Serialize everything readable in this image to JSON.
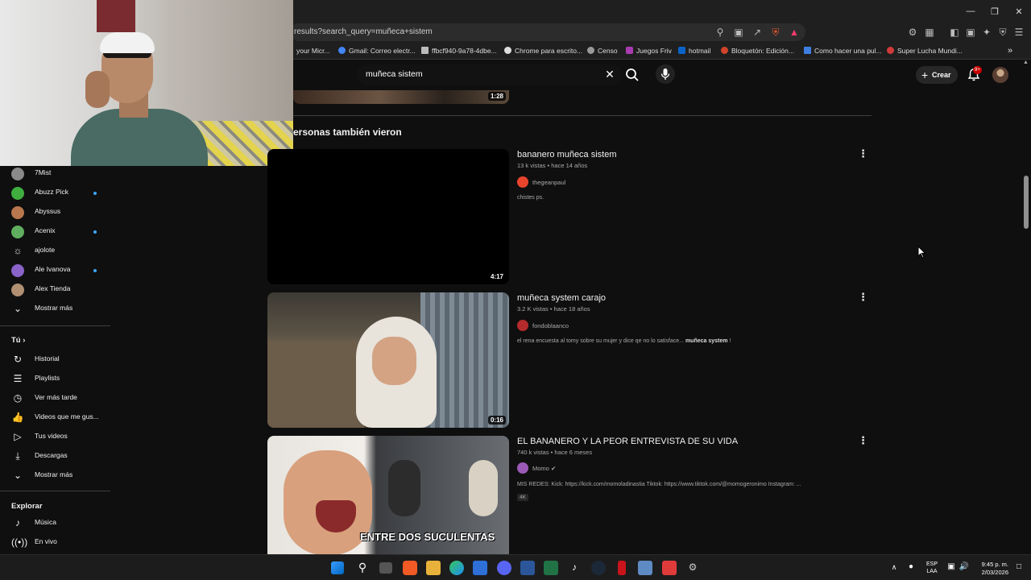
{
  "browser": {
    "url": "results?search_query=muñeca+sistem",
    "bookmarks": [
      "your Micr...",
      "Gmail: Correo electr...",
      "ffbcf940-9a78-4dbe...",
      "Chrome para escrito...",
      "Censo",
      "Juegos Friv",
      "hotmail",
      "Bloquetón: Edición...",
      "Como hacer una pul...",
      "Super Lucha Mundi..."
    ]
  },
  "header": {
    "search_value": "muñeca sistem",
    "create_label": "Crear",
    "notification_badge": "9+"
  },
  "sidebar": {
    "subscriptions": [
      {
        "label": "7Mist",
        "color": "#8a8a8a",
        "dot": false
      },
      {
        "label": "Abuzz Pick",
        "color": "#3fae3f",
        "dot": true
      },
      {
        "label": "Abyssus",
        "color": "#b8774d",
        "dot": false
      },
      {
        "label": "Acenix",
        "color": "#5fae5f",
        "dot": true
      },
      {
        "label": "ajolote",
        "color": "#d8d8d8",
        "dot": false
      },
      {
        "label": "Ale Ivanova",
        "color": "#8a63c9",
        "dot": true
      },
      {
        "label": "Alex Tienda",
        "color": "#b08f73",
        "dot": false
      }
    ],
    "show_more_1": "Mostrar más",
    "you_section": "Tú",
    "you_items": [
      {
        "label": "Historial",
        "icon": "history-icon"
      },
      {
        "label": "Playlists",
        "icon": "playlists-icon"
      },
      {
        "label": "Ver más tarde",
        "icon": "clock-icon"
      },
      {
        "label": "Videos que me gus...",
        "icon": "thumbs-up-icon"
      },
      {
        "label": "Tus videos",
        "icon": "your-videos-icon"
      },
      {
        "label": "Descargas",
        "icon": "download-icon"
      }
    ],
    "show_more_2": "Mostrar más",
    "explore_section": "Explorar",
    "explore_items": [
      {
        "label": "Música",
        "icon": "music-icon"
      },
      {
        "label": "En vivo",
        "icon": "live-icon"
      }
    ]
  },
  "main": {
    "prev_duration": "1:28",
    "section_title": "ersonas también vieron",
    "videos": [
      {
        "title": "bananero muñeca sistem",
        "meta": "13 k vistas • hace 14 años",
        "channel": "thegeanpaul",
        "channel_color": "#e8452c",
        "description": "chistes ps.",
        "duration": "4:17"
      },
      {
        "title": "muñeca system carajo",
        "meta": "3.2 K vistas • hace 18 años",
        "channel": "fondoblaanco",
        "channel_color": "#b52b2b",
        "description": "el rena encuesta al tomy sobre su mujer y dice qe no lo satisface...",
        "description_bold": "muñeca system",
        "description_end": "!",
        "duration": "0:16"
      },
      {
        "title": "EL BANANERO Y LA PEOR ENTREVISTA DE SU VIDA",
        "meta": "740 k vistas • hace 6 meses",
        "channel": "Momo",
        "channel_color": "#9b59b6",
        "description": "MIS REDES: Kick: https://kick.com/momoladinastia Tiktok: https://www.tiktok.com/@momogeronimo Instagram: ...",
        "badge": "4K",
        "thumb_text": "ENTRE DOS SUCULENTAS"
      }
    ]
  },
  "taskbar": {
    "lang_top": "ESP",
    "lang_bottom": "LAA",
    "time": "9:45 p. m.",
    "date": "2/03/2026"
  }
}
